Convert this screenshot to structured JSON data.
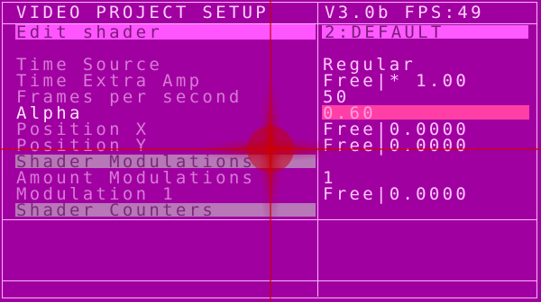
{
  "header": {
    "title": "VIDEO PROJECT SETUP",
    "version": "V3.0b FPS:49"
  },
  "menu": {
    "selected_label": "Edit shader",
    "selected_value": "2:DEFAULT",
    "rows": [
      {
        "label": "Time Source",
        "value": "Regular"
      },
      {
        "label": "Time Extra Amp",
        "value": "Free|* 1.00"
      },
      {
        "label": "Frames per second",
        "value": "50"
      },
      {
        "label": "Alpha",
        "value": "0.60"
      },
      {
        "label": "Position X",
        "value": "Free|0.0000"
      },
      {
        "label": "Position Y",
        "value": "Free|0.0000"
      },
      {
        "label": "Shader Modulations",
        "value": ""
      },
      {
        "label": "Amount Modulations",
        "value": "1"
      },
      {
        "label": "Modulation 1",
        "value": "Free|0.0000"
      },
      {
        "label": "Shader Counters",
        "value": ""
      }
    ]
  },
  "colors": {
    "background": "#a000a0",
    "highlight": "#ff55ff",
    "alpha_bar": "#ff3fa5",
    "crosshair": "#cc0000"
  },
  "icons": {
    "crosshair": "crosshair-icon"
  }
}
